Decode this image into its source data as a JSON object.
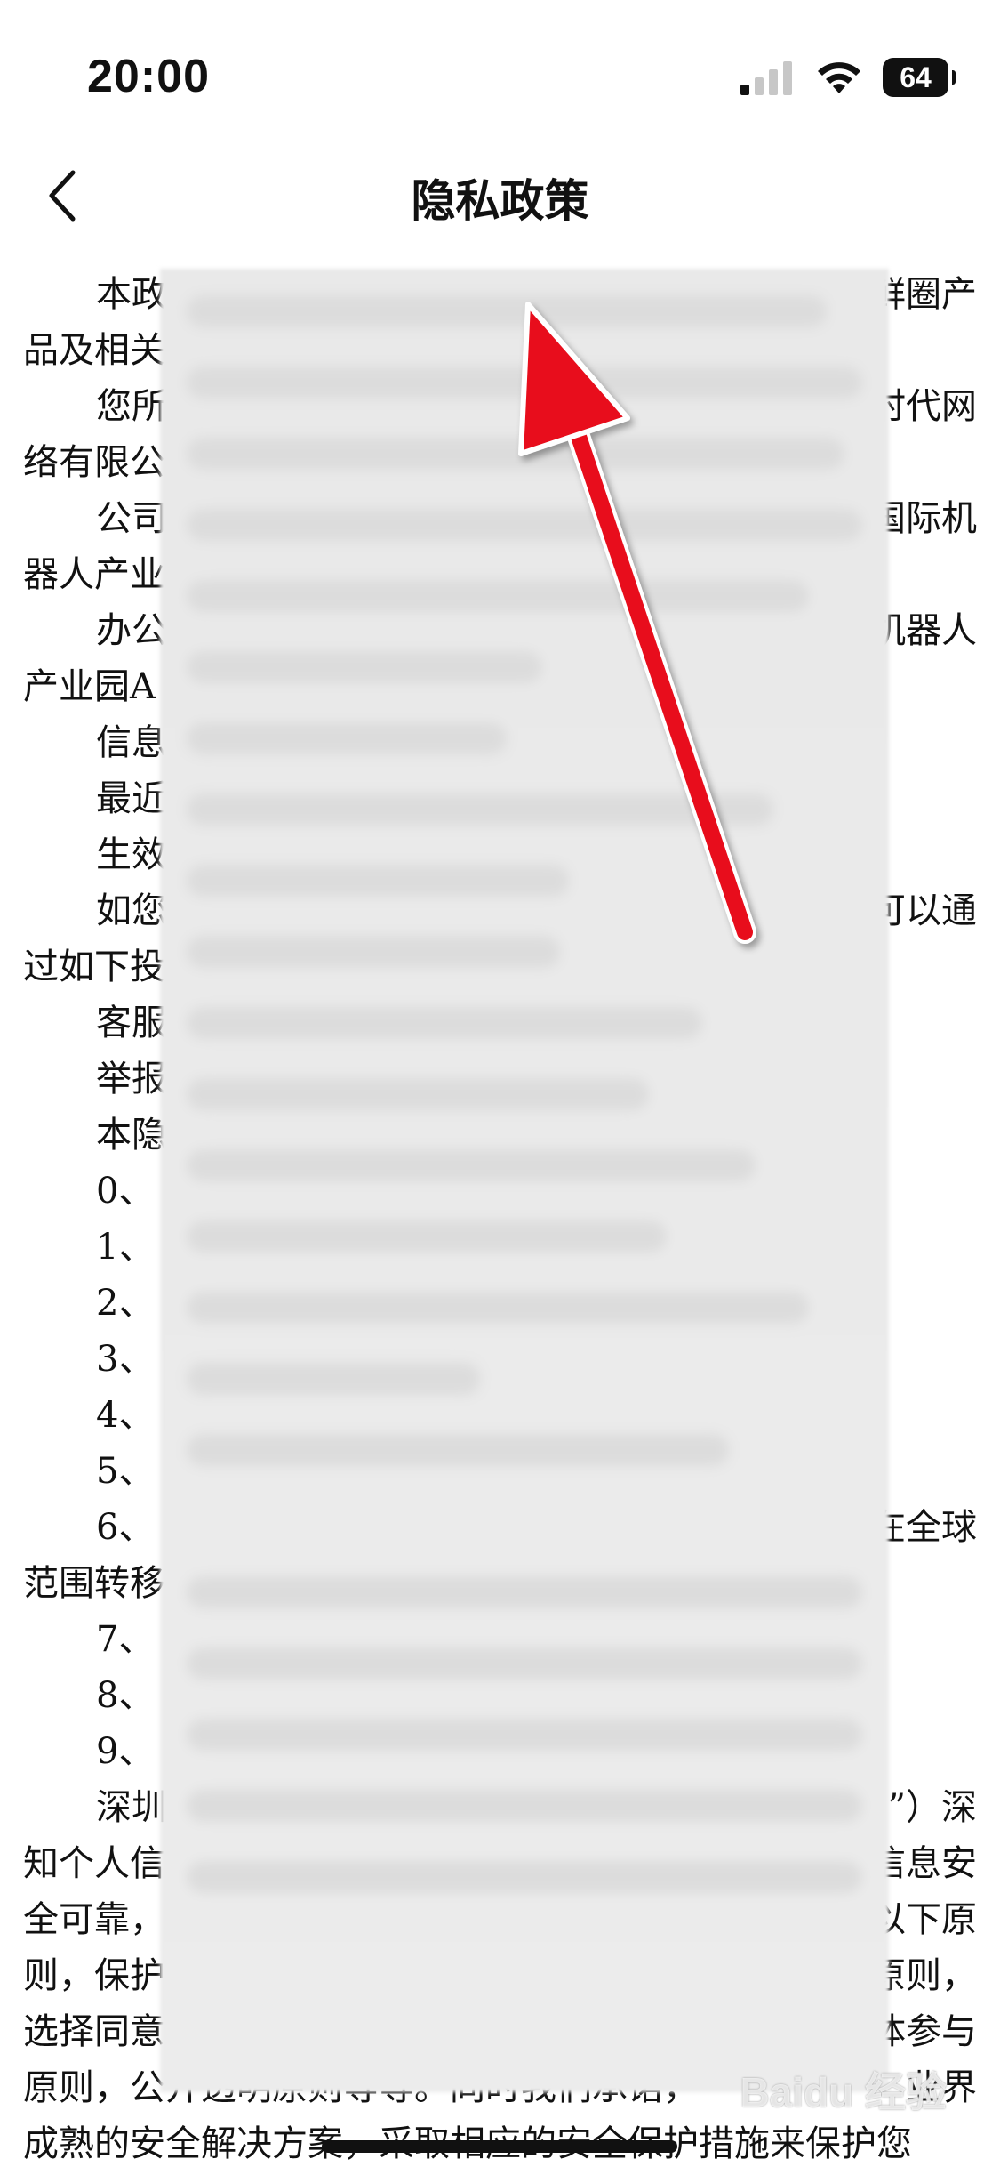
{
  "status_bar": {
    "time": "20:00",
    "battery": "64"
  },
  "nav": {
    "title": "隐私政策"
  },
  "document": {
    "lines": [
      {
        "left": "本政",
        "right": "鲜圈产",
        "indent": true
      },
      {
        "left": "品及相关",
        "right": "",
        "indent": false
      },
      {
        "left": "您所",
        "right": "时代网",
        "indent": true
      },
      {
        "left": "络有限公",
        "right": "",
        "indent": false
      },
      {
        "left": "公司",
        "right": "国际机",
        "indent": true
      },
      {
        "left": "器人产业",
        "right": "",
        "indent": false
      },
      {
        "left": "办公",
        "right": "机器人",
        "indent": true
      },
      {
        "left": "产业园A",
        "right": "",
        "indent": false
      },
      {
        "left": "信息",
        "right": "",
        "indent": true
      },
      {
        "left": "最近",
        "right": "",
        "indent": true
      },
      {
        "left": "生效",
        "right": "",
        "indent": true
      },
      {
        "left": "如您",
        "right": "可以通",
        "indent": true
      },
      {
        "left": "过如下投",
        "right": "",
        "indent": false
      },
      {
        "left": "客服",
        "right": "",
        "indent": true
      },
      {
        "left": "举报",
        "right": "",
        "indent": true
      },
      {
        "left": "本隐",
        "right": "",
        "indent": true
      },
      {
        "left": "0、",
        "right": "",
        "indent": true
      },
      {
        "left": "1、",
        "right": "",
        "indent": true
      },
      {
        "left": "2、",
        "right": "",
        "indent": true
      },
      {
        "left": "3、",
        "right": "",
        "indent": true
      },
      {
        "left": "4、",
        "right": "",
        "indent": true
      },
      {
        "left": "5、",
        "right": "",
        "indent": true
      },
      {
        "left": "6、",
        "right": "在全球",
        "indent": true
      },
      {
        "left": "范围转移",
        "right": "",
        "indent": false
      },
      {
        "left": "7、",
        "right": "",
        "indent": true
      },
      {
        "left": "8、",
        "right": "",
        "indent": true
      },
      {
        "left": "9、",
        "right": "",
        "indent": true
      },
      {
        "left": "深圳",
        "right": "”）深",
        "indent": true
      },
      {
        "left": "知个人信",
        "right": "信息安",
        "indent": false
      },
      {
        "left": "全可靠，",
        "right": "以下原",
        "indent": false
      },
      {
        "left": "则，保护",
        "right": "原则，",
        "indent": false
      },
      {
        "left": "选择同意",
        "right": "体参与",
        "indent": false
      },
      {
        "left": "原则，公开透明原则等等。同时我们承诺，",
        "right": "业界",
        "indent": false
      },
      {
        "left": "成熟的安全解决方案，采取相应的安全保护措施来保护您",
        "right": "",
        "indent": false
      }
    ]
  },
  "watermark": "Baidu 经验",
  "colors": {
    "arrow": "#e8101a",
    "text": "#111111",
    "blur": "#e9e9e9"
  },
  "icons": {
    "back": "chevron-left-icon",
    "signal": "cellular-signal-icon",
    "wifi": "wifi-icon",
    "battery": "battery-icon"
  }
}
